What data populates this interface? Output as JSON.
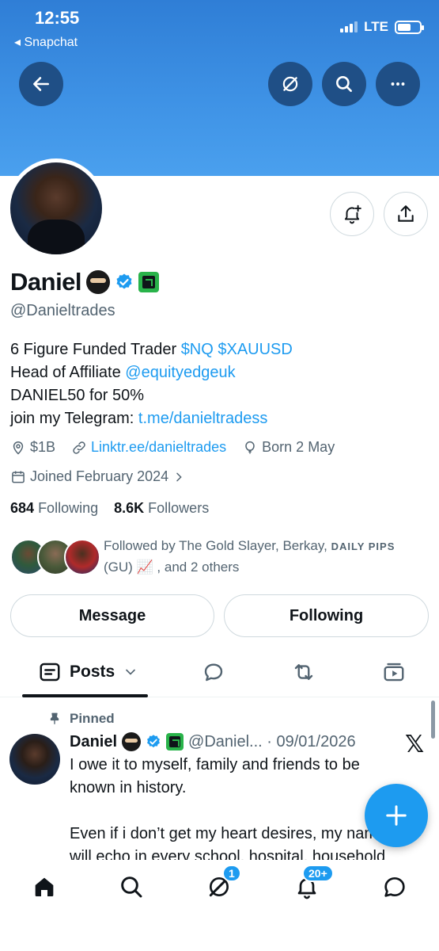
{
  "status_bar": {
    "time": "12:55",
    "back_app": "◂ Snapchat",
    "network": "LTE"
  },
  "profile": {
    "name": "Daniel",
    "handle": "@Danieltrades",
    "bio": {
      "line1_text": "6 Figure Funded Trader ",
      "line1_link": "$NQ $XAUUSD",
      "line2_text": "Head of Affiliate ",
      "line2_link": "@equityedgeuk",
      "line3_text": "DANIEL50 for 50%",
      "line4_text": "join my Telegram: ",
      "line4_link": "t.me/danieltradess"
    },
    "location": "$1B",
    "website": "Linktr.ee/danieltrades",
    "birthday": "Born 2 May",
    "joined": "Joined February 2024",
    "following_count": "684",
    "following_label": "Following",
    "followers_count": "8.6K",
    "followers_label": "Followers",
    "followed_by_prefix": "Followed by The Gold Slayer, Berkay, ",
    "followed_by_caps": "DAILY PIPS",
    "followed_by_mid": "(GU) 📈 , and 2 others",
    "message_button": "Message",
    "following_button": "Following"
  },
  "tabs": {
    "posts_label": "Posts"
  },
  "post": {
    "pinned_label": "Pinned",
    "author": "Daniel",
    "meta": "@Daniel... · 09/01/2026",
    "para1": "I owe it to myself, family and friends to be known in history.",
    "para2": "Even if i don’t get my heart desires, my name will echo in every school, hospital, household"
  },
  "nav": {
    "messages_badge": "1",
    "notifications_badge": "20+"
  },
  "colors": {
    "accent": "#1d9bf0",
    "banner": "#3f93e6",
    "affiliate_green": "#29b34a"
  }
}
